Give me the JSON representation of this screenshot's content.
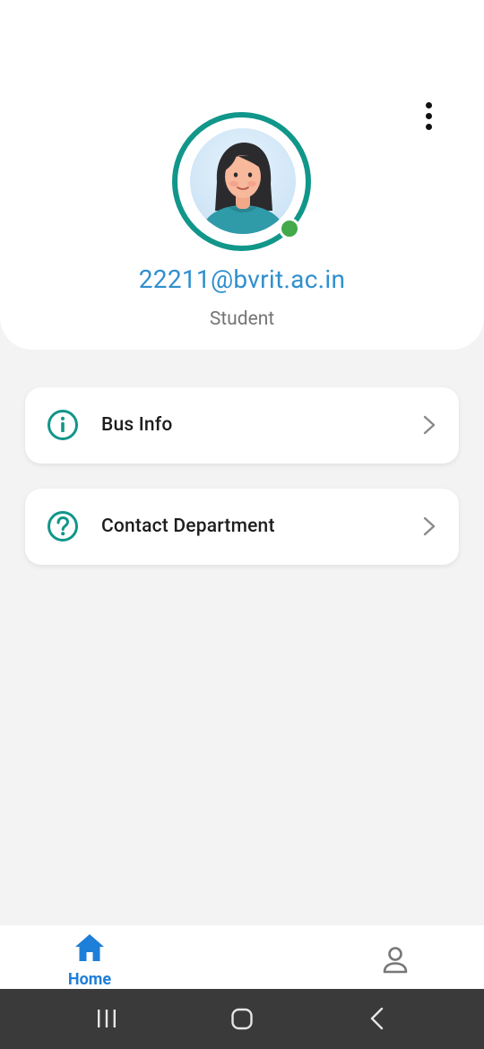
{
  "profile": {
    "email": "22211@bvrit.ac.in",
    "role": "Student",
    "status": "online",
    "colors": {
      "ring": "#11968a",
      "email": "#2f8fce",
      "online": "#43a94a"
    }
  },
  "menu": {
    "items": [
      {
        "label": "Bus Info",
        "icon": "info-icon"
      },
      {
        "label": "Contact Department",
        "icon": "help-icon"
      }
    ]
  },
  "bottom_nav": {
    "items": [
      {
        "label": "Home",
        "icon": "home-icon",
        "active": true
      },
      {
        "label": "",
        "icon": "profile-icon",
        "active": false
      }
    ],
    "active_color": "#1e7fd8"
  },
  "system_nav": {
    "buttons": [
      "recents-icon",
      "home-circle-icon",
      "back-icon"
    ]
  }
}
